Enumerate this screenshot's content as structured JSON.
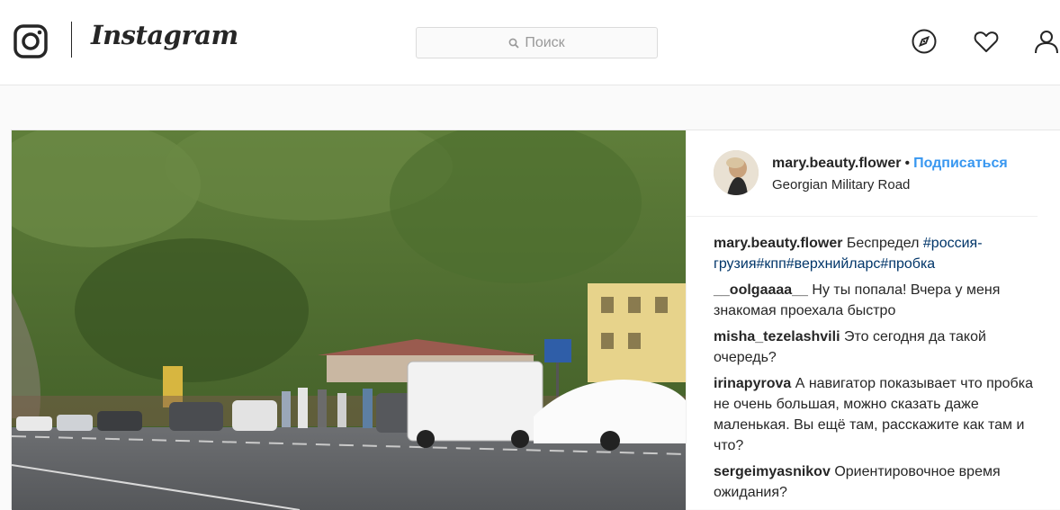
{
  "app": {
    "brand": "Instagram"
  },
  "search": {
    "placeholder": "Поиск"
  },
  "nav": {
    "icons": [
      "explore-icon",
      "heart-icon",
      "profile-icon"
    ]
  },
  "post": {
    "author": "mary.beauty.flower",
    "separator": "•",
    "follow_label": "Подписаться",
    "location": "Georgian Military Road",
    "caption": {
      "user": "mary.beauty.flower",
      "text": "Беспредел ",
      "tags": [
        "#россия-грузия",
        "#кпп",
        "#верхнийларс",
        "#пробка"
      ]
    },
    "comments": [
      {
        "user": "__oolgaaaa__",
        "text": "Ну ты попала! Вчера у меня знакомая проехала быстро"
      },
      {
        "user": "misha_tezelashvili",
        "text": "Это сегодня да такой очередь?"
      },
      {
        "user": "irinapyrova",
        "text": "А навигатор показывает что пробка не очень большая, можно сказать даже маленькая. Вы ещё там, расскажите как там и что?"
      },
      {
        "user": "sergeimyasnikov",
        "text": "Ориентировочное время ожидания?"
      }
    ]
  },
  "colors": {
    "link": "#3897f0",
    "hashtag": "#003569",
    "border": "#efefef"
  }
}
